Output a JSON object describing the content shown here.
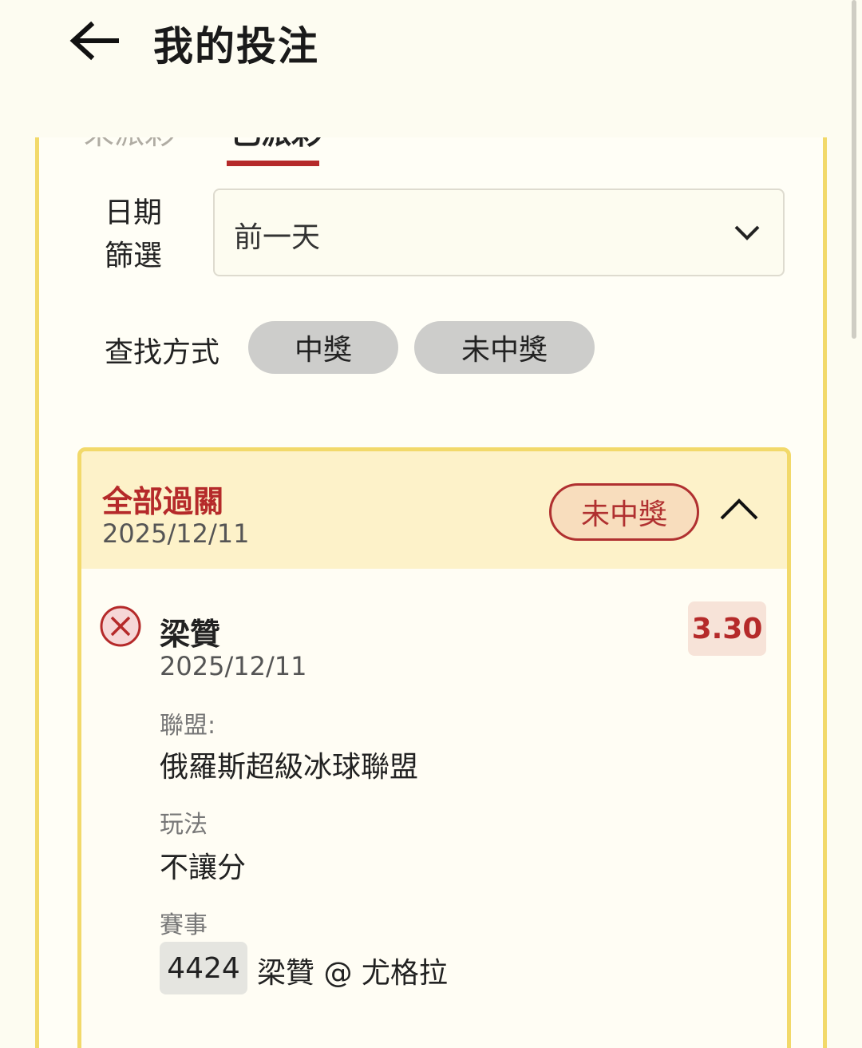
{
  "header": {
    "title": "我的投注"
  },
  "tabs": [
    {
      "label": "未派彩"
    },
    {
      "label": "已派彩"
    }
  ],
  "filter": {
    "date_label_line1": "日期",
    "date_label_line2": "篩選",
    "date_value": "前一天",
    "search_label": "查找方式",
    "options": [
      "中獎",
      "未中獎"
    ]
  },
  "bet": {
    "type": "全部過關",
    "date": "2025/12/11",
    "status": "未中獎",
    "selection": {
      "name": "梁贊",
      "date": "2025/12/11",
      "odds": "3.30",
      "league_label": "聯盟:",
      "league": "俄羅斯超級冰球聯盟",
      "market_label": "玩法",
      "market": "不讓分",
      "event_label": "賽事",
      "event_code": "4424",
      "event_name": "梁贊 @ 尤格拉"
    }
  },
  "colors": {
    "accent": "#b52a2a",
    "panel_border": "#f2d96a",
    "card_header": "#fdf2c9",
    "background": "#fdfcf1"
  }
}
